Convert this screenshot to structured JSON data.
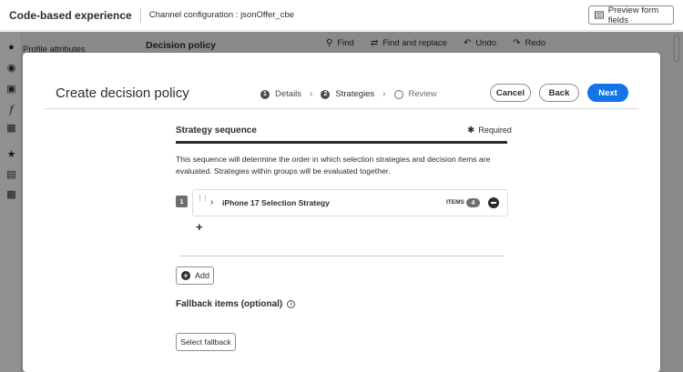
{
  "topbar": {
    "app_title": "Code-based experience",
    "channel_config": "Channel configuration : jsonOffer_cbe",
    "preview_label": "Preview form fields"
  },
  "background": {
    "profile_attributes": "Profile attributes",
    "panel_title": "Decision policy",
    "toolbar": {
      "find": "Find",
      "find_replace": "Find and replace",
      "undo": "Undo",
      "redo": "Redo"
    },
    "rail_icons": [
      "user-icon",
      "palette-icon",
      "image-pick-icon",
      "function-icon",
      "grid-icon",
      "star-icon",
      "form-icon",
      "card-icon"
    ]
  },
  "modal": {
    "title": "Create decision policy",
    "steps": [
      {
        "num": "1",
        "label": "Details",
        "state": "done"
      },
      {
        "num": "2",
        "label": "Strategies",
        "state": "current"
      },
      {
        "num": "",
        "label": "Review",
        "state": "upcoming"
      }
    ],
    "cancel_label": "Cancel",
    "back_label": "Back",
    "next_label": "Next",
    "section_title": "Strategy sequence",
    "required_label": "Required",
    "description": "This sequence will determine the order in which selection strategies and decision items are evaluated. Strategies within groups will be evaluated together.",
    "sequence": [
      {
        "order": "1",
        "name": "iPhone 17 Selection Strategy",
        "items_label": "ITEMS",
        "items_count": "4"
      }
    ],
    "add_label": "Add",
    "fallback_title": "Fallback items (optional)",
    "select_fallback_label": "Select fallback"
  },
  "colors": {
    "primary": "#1473e6",
    "text": "#2c2c2c",
    "badge": "#6e6e6e"
  }
}
